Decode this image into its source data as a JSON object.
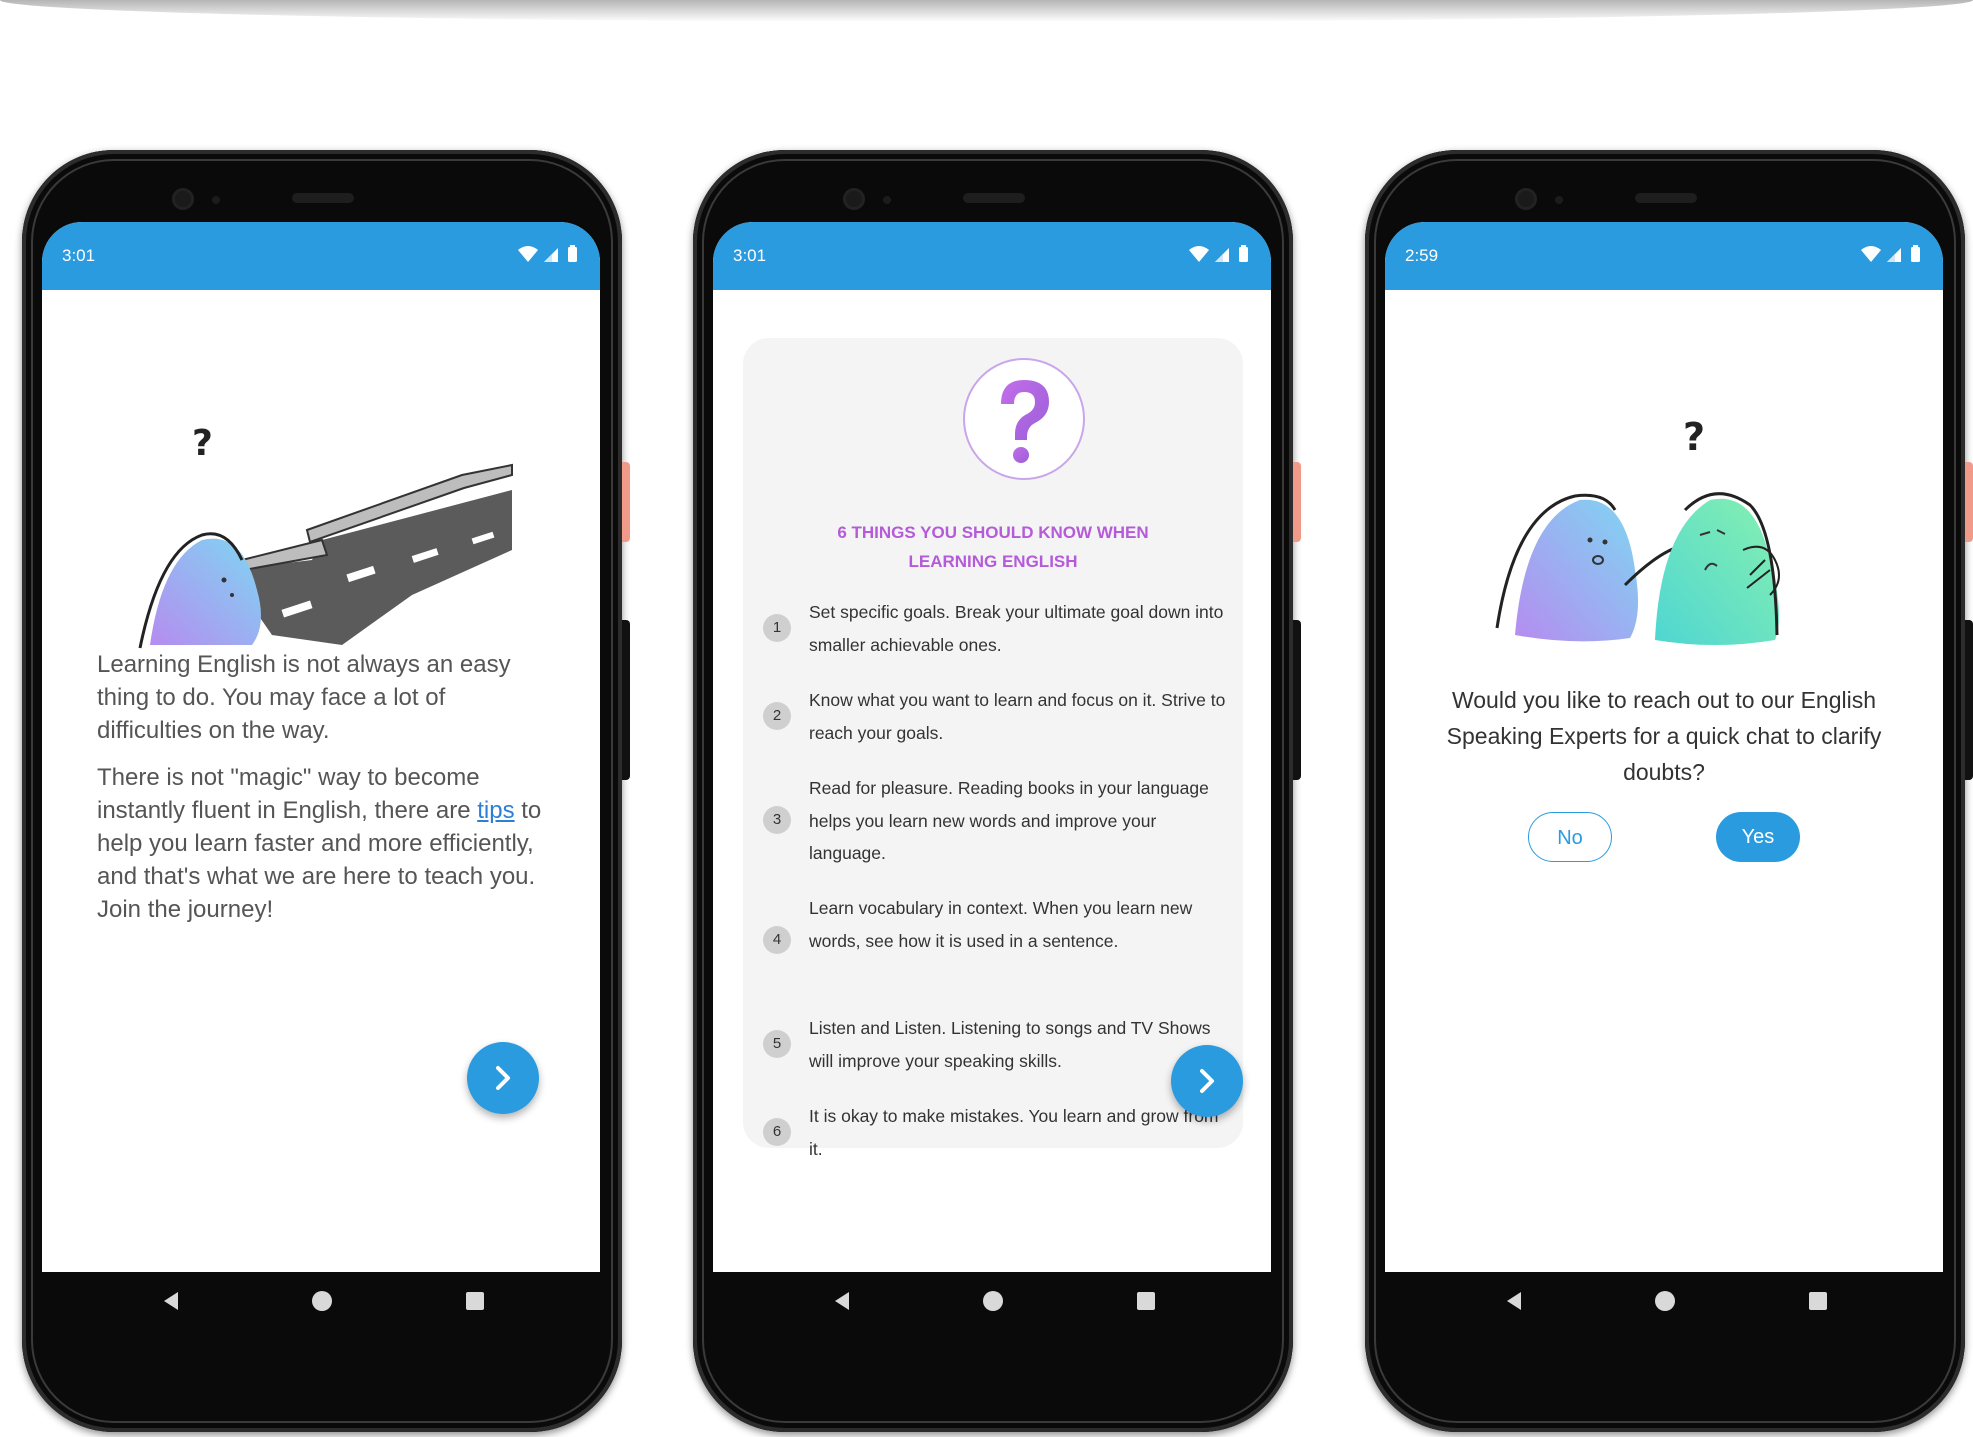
{
  "screens": [
    {
      "time": "3:01",
      "paragraph1": "Learning English is not always an easy thing to do. You may face a lot of difficulties on the way.",
      "paragraph2_before": "There is not \"magic\" way to become instantly fluent in English, there are ",
      "paragraph2_link": "tips",
      "paragraph2_after": " to help you learn faster and more efficiently, and that's what we are here to teach you. Join the journey!",
      "next_icon": "chevron-right-icon"
    },
    {
      "time": "3:01",
      "card_title_line1": "6 THINGS YOU SHOULD KNOW WHEN",
      "card_title_line2": "LEARNING ENGLISH",
      "tips": [
        {
          "num": "1",
          "text": "Set specific goals. Break your ultimate goal down into smaller achievable ones."
        },
        {
          "num": "2",
          "text": "Know what you want to learn and focus on it. Strive to reach your goals."
        },
        {
          "num": "3",
          "text": "Read for pleasure. Reading books in your language helps you learn new words and improve your language."
        },
        {
          "num": "4",
          "text": "Learn vocabulary in context. When you learn new words, see how it is used in a sentence."
        },
        {
          "num": "5",
          "text": "Listen and Listen. Listening to songs and TV Shows will improve your speaking skills."
        },
        {
          "num": "6",
          "text": "It is okay to make mistakes. You learn and grow from it."
        }
      ],
      "next_icon": "chevron-right-icon"
    },
    {
      "time": "2:59",
      "question": "Would you like to reach out to our English Speaking Experts for a quick chat to clarify doubts?",
      "no_label": "No",
      "yes_label": "Yes"
    }
  ],
  "colors": {
    "primary": "#2b9be0",
    "title_purple": "#b55ad9",
    "link": "#2b7fd6"
  }
}
